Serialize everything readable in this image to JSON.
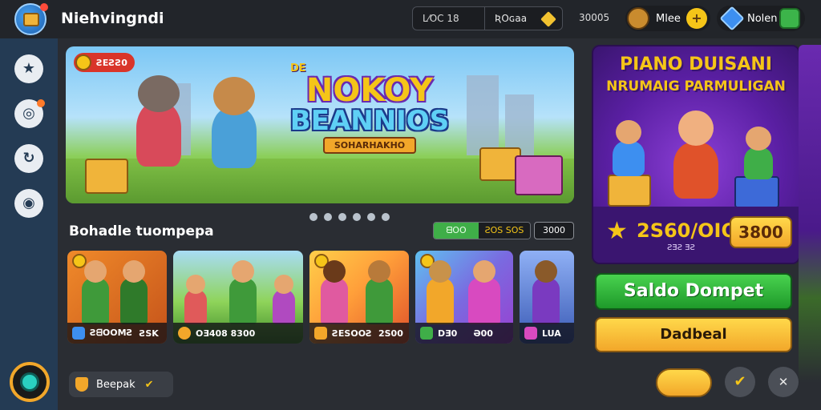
{
  "app": {
    "title": "Niehvingndi"
  },
  "topbar": {
    "search_left": "L⁄OC 18",
    "search_right": "ƦOɢaa",
    "count": "30005",
    "coins_label": "Mlee",
    "coins_add": "+",
    "gems_label": "Nolen"
  },
  "sidebar": {
    "items": [
      {
        "icon": "star-icon",
        "glyph": "★"
      },
      {
        "icon": "target-icon",
        "glyph": "◎"
      },
      {
        "icon": "refresh-icon",
        "glyph": "↻"
      },
      {
        "icon": "record-icon",
        "glyph": "◉"
      }
    ]
  },
  "hero": {
    "tag": "ƧEƧƧ0",
    "small": "DE",
    "line1": "NOKOY",
    "line2": "BEANNIOS",
    "ribbon": "SOHARHAKHO"
  },
  "carousel": {
    "dots": 6
  },
  "section": {
    "title": "Bohadle tuompepa",
    "toggle_a": "ᗺOO",
    "toggle_b": "ƧOS SOS",
    "button": "3000"
  },
  "cards": [
    {
      "value": "ƧᗺOOMƧ",
      "extra": "ƧSK",
      "colors": [
        "#f08a2a",
        "#c5531a"
      ]
    },
    {
      "value": "OƎ408 8300",
      "extra": "",
      "colors": [
        "#8fd45a",
        "#3f8a2a"
      ]
    },
    {
      "value": "ƧESOOƧ",
      "extra": "2S00",
      "colors": [
        "#ff9f3a",
        "#e0522a"
      ]
    },
    {
      "value": "DƎ0",
      "extra": "Ə00",
      "colors": [
        "#5fc0f0",
        "#9a3fd0"
      ]
    },
    {
      "value": "LUA",
      "extra": "",
      "colors": [
        "#8fb0f5",
        "#3a5ab5"
      ]
    }
  ],
  "promo": {
    "title1": "PIANO DUISANI",
    "title2": "NRUMAIG PARMULIGAN",
    "amount": "2S60/OIO",
    "sub": "ƧƎƧ ƎƧ",
    "button": "3800"
  },
  "actions": {
    "primary": "Saldo Dompet",
    "secondary": "Dadbeal"
  },
  "bottom": {
    "pill_label": "Beepak",
    "pill_check": "✔",
    "round1": "✔",
    "round2": "✕"
  },
  "colors": {
    "background": "#2a2d33",
    "sidebar": "#243b54",
    "accent_green": "#3fae48",
    "accent_yellow": "#f5c518",
    "promo_purple": "#5a1fa3"
  }
}
